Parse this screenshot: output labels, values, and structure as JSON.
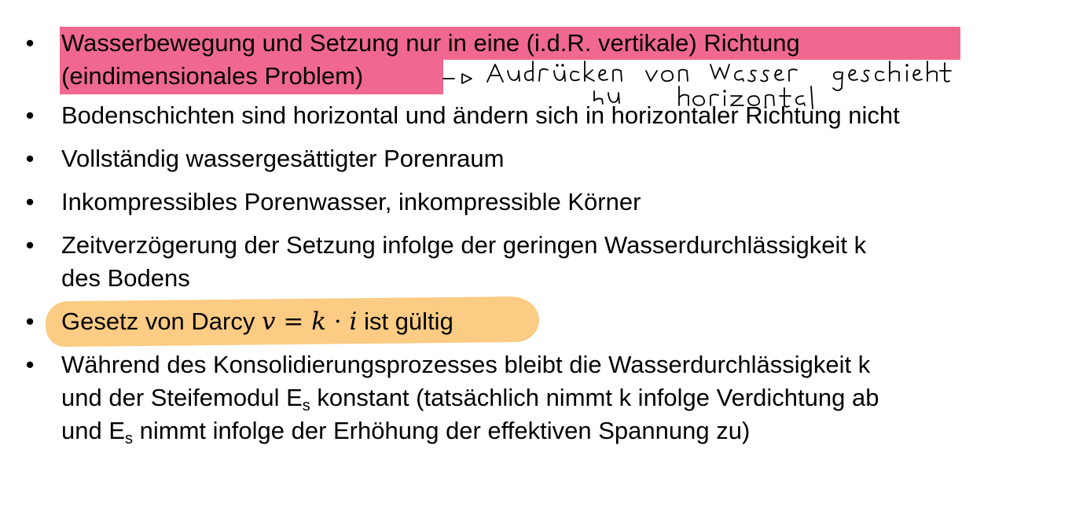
{
  "bullets": [
    {
      "line1": "Wasserbewegung und Setzung nur in eine (i.d.R. vertikale) Richtung",
      "line2": "(eindimensionales Problem)"
    },
    {
      "text": "Bodenschichten sind horizontal und ändern sich in horizontaler Richtung nicht"
    },
    {
      "text": "Vollständig wassergesättigter Porenraum"
    },
    {
      "text": "Inkompressibles Porenwasser, inkompressible Körner"
    },
    {
      "line1": "Zeitverzögerung der Setzung infolge der geringen Wasserdurchlässigkeit k",
      "line2": "des Bodens"
    },
    {
      "prefix": "Gesetz von Darcy ",
      "math_v": "v",
      "math_eq": " = ",
      "math_k": "k",
      "math_dot": " · ",
      "math_i": "i",
      "suffix": " ist gültig"
    },
    {
      "line1": "Während des Konsolidierungsprozesses bleibt die Wasserdurchlässigkeit k",
      "line2_a": "und der Steifemodul E",
      "line2_sub": "s",
      "line2_b": " konstant (tatsächlich nimmt k infolge Verdichtung ab",
      "line3_a": "und E",
      "line3_sub": "s",
      "line3_b": " nimmt infolge der Erhöhung der effektiven Spannung zu)"
    }
  ],
  "bullet_symbol": "•",
  "annotation_handwritten": "-> Ausdrücken von Wasser geschieht nur horizontal",
  "colors": {
    "pink_highlight": "#f06890",
    "orange_highlight": "#fcc87a",
    "text": "#000000",
    "background": "#ffffff"
  }
}
